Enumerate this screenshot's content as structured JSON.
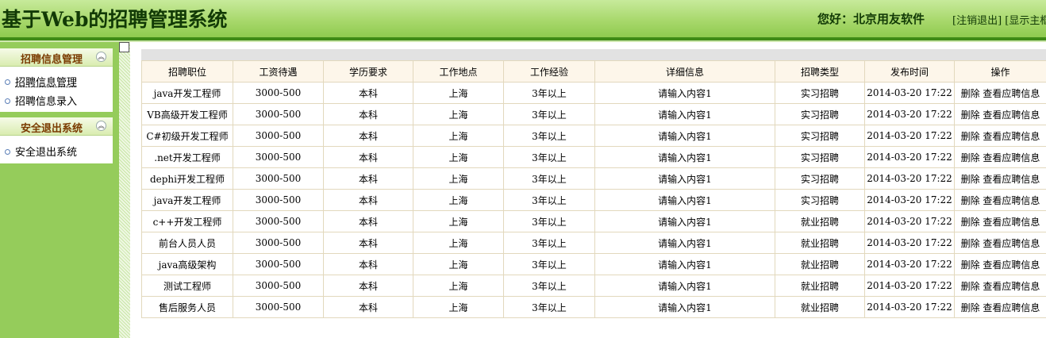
{
  "header": {
    "title": "基于Web的招聘管理系统",
    "greeting": "您好：北京用友软件",
    "logout_link": "[注销退出]",
    "main_frame_link": "[显示主框架]"
  },
  "sidebar": {
    "panels": [
      {
        "title": "招聘信息管理",
        "items": [
          "招聘信息管理",
          "招聘信息录入"
        ]
      },
      {
        "title": "安全退出系统",
        "items": [
          "安全退出系统"
        ]
      }
    ]
  },
  "table": {
    "columns": [
      "招聘职位",
      "工资待遇",
      "学历要求",
      "工作地点",
      "工作经验",
      "详细信息",
      "招聘类型",
      "发布时间",
      "操作"
    ],
    "rows": [
      [
        "java开发工程师",
        "3000-500",
        "本科",
        "上海",
        "3年以上",
        "请输入内容1",
        "实习招聘",
        "2014-03-20 17:22"
      ],
      [
        "VB高级开发工程师",
        "3000-500",
        "本科",
        "上海",
        "3年以上",
        "请输入内容1",
        "实习招聘",
        "2014-03-20 17:22"
      ],
      [
        "C#初级开发工程师",
        "3000-500",
        "本科",
        "上海",
        "3年以上",
        "请输入内容1",
        "实习招聘",
        "2014-03-20 17:22"
      ],
      [
        ".net开发工程师",
        "3000-500",
        "本科",
        "上海",
        "3年以上",
        "请输入内容1",
        "实习招聘",
        "2014-03-20 17:22"
      ],
      [
        "dephi开发工程师",
        "3000-500",
        "本科",
        "上海",
        "3年以上",
        "请输入内容1",
        "实习招聘",
        "2014-03-20 17:22"
      ],
      [
        "java开发工程师",
        "3000-500",
        "本科",
        "上海",
        "3年以上",
        "请输入内容1",
        "实习招聘",
        "2014-03-20 17:22"
      ],
      [
        "c++开发工程师",
        "3000-500",
        "本科",
        "上海",
        "3年以上",
        "请输入内容1",
        "就业招聘",
        "2014-03-20 17:22"
      ],
      [
        "前台人员人员",
        "3000-500",
        "本科",
        "上海",
        "3年以上",
        "请输入内容1",
        "就业招聘",
        "2014-03-20 17:22"
      ],
      [
        "java高级架构",
        "3000-500",
        "本科",
        "上海",
        "3年以上",
        "请输入内容1",
        "就业招聘",
        "2014-03-20 17:22"
      ],
      [
        "测试工程师",
        "3000-500",
        "本科",
        "上海",
        "3年以上",
        "请输入内容1",
        "就业招聘",
        "2014-03-20 17:22"
      ],
      [
        "售后服务人员",
        "3000-500",
        "本科",
        "上海",
        "3年以上",
        "请输入内容1",
        "就业招聘",
        "2014-03-20 17:22"
      ]
    ],
    "action_delete": "删除",
    "action_view": "查看应聘信息"
  },
  "icons": {
    "collapse": "double-chevron-up-icon",
    "bullet": "circle-bullet-icon"
  },
  "colors": {
    "header_green": "#a8d86c",
    "header_line": "#3f8a16",
    "sidebar_green": "#95cc5b",
    "panel_title": "#7a3a00",
    "grid_border": "#e2d8bd"
  }
}
